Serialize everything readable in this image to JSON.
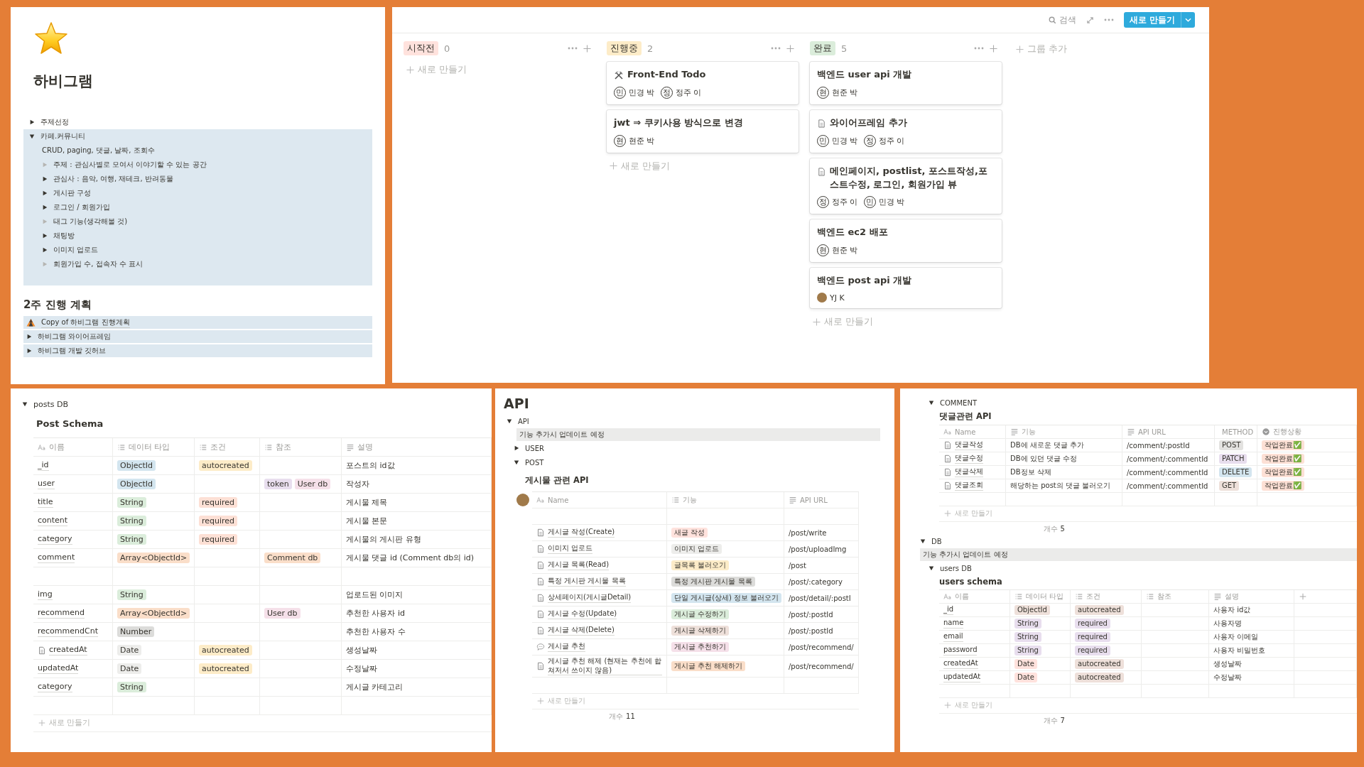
{
  "overview": {
    "title": "하비그램",
    "toggles": [
      {
        "label": "주제선정",
        "expanded": false,
        "empty": false
      },
      {
        "label": "카페.커뮤니티",
        "expanded": true,
        "empty": false,
        "note": "CRUD, paging, 댓글, 날짜, 조회수",
        "children": [
          {
            "label": "주제 : 관심사별로 모여서 이야기할 수 있는 공간",
            "expanded": false,
            "empty": true
          },
          {
            "label": "관심사 : 음악, 여행, 재테크, 반려동물",
            "expanded": false,
            "empty": false
          },
          {
            "label": "게시판 구성",
            "expanded": false,
            "empty": false
          },
          {
            "label": "로그인 / 회원가입",
            "expanded": false,
            "empty": false
          },
          {
            "label": "태그 기능(생각해볼 것)",
            "expanded": false,
            "empty": true
          },
          {
            "label": "채팅방",
            "expanded": false,
            "empty": false
          },
          {
            "label": "이미지 업로드",
            "expanded": false,
            "empty": false
          },
          {
            "label": "회원가입 수, 접속자 수 표시",
            "expanded": false,
            "empty": true
          }
        ]
      }
    ],
    "plan_title": "2주 진행 계획",
    "plan_items": [
      {
        "kind": "link",
        "label": "Copy of 하비그램 진행계획"
      },
      {
        "kind": "toggle",
        "label": "하비그램 와이어프레임",
        "expanded": false
      },
      {
        "kind": "toggle",
        "label": "하비그램 개발 깃허브",
        "expanded": false
      }
    ]
  },
  "board": {
    "search": "검색",
    "new_button": "새로 만들기",
    "add_group": "그룹 추가",
    "columns": [
      {
        "label": "시작전",
        "count": "0",
        "color": "#ffe2dd",
        "new_label": "새로 만들기"
      },
      {
        "label": "진행중",
        "count": "2",
        "color": "#fdecc8",
        "new_label": "새로 만들기",
        "cards": [
          {
            "kind": "tools",
            "title": "Front-End Todo",
            "people": [
              {
                "kind": "initial",
                "initial": "민",
                "name": "민경 박"
              },
              {
                "kind": "initial",
                "initial": "정",
                "name": "정주 이"
              }
            ]
          },
          {
            "kind": "plain",
            "title": "jwt ⇒ 쿠키사용 방식으로 변경",
            "people": [
              {
                "kind": "initial",
                "initial": "현",
                "name": "현준 박"
              }
            ]
          }
        ]
      },
      {
        "label": "완료",
        "count": "5",
        "color": "#dbeddb",
        "new_label": "새로 만들기",
        "cards": [
          {
            "kind": "plain",
            "title": "백엔드 user api 개발",
            "people": [
              {
                "kind": "initial",
                "initial": "현",
                "name": "현준 박"
              }
            ]
          },
          {
            "kind": "page",
            "title": "와이어프레임 추가",
            "people": [
              {
                "kind": "initial",
                "initial": "민",
                "name": "민경 박"
              },
              {
                "kind": "initial",
                "initial": "정",
                "name": "정주 이"
              }
            ]
          },
          {
            "kind": "page",
            "title": "메인페이지, postlist, 포스트작성,포스트수정,  로그인, 회원가입 뷰",
            "people": [
              {
                "kind": "initial",
                "initial": "정",
                "name": "정주 이"
              },
              {
                "kind": "initial",
                "initial": "민",
                "name": "민경 박"
              }
            ]
          },
          {
            "kind": "plain",
            "title": "백엔드 ec2 배포",
            "people": [
              {
                "kind": "initial",
                "initial": "현",
                "name": "현준 박"
              }
            ]
          },
          {
            "kind": "plain",
            "title": "백엔드 post api 개발",
            "people": [
              {
                "kind": "photo",
                "name": "YJ K"
              }
            ]
          }
        ]
      }
    ]
  },
  "posts_db": {
    "label": "posts DB",
    "expanded": true,
    "table_title": "Post Schema",
    "table": {
      "columns": [
        {
          "label": "이름",
          "kind": "title"
        },
        {
          "label": "데이터 타입",
          "kind": "multi"
        },
        {
          "label": "조건",
          "kind": "multi"
        },
        {
          "label": "참조",
          "kind": "multi"
        },
        {
          "label": "설명",
          "kind": "text"
        }
      ],
      "rows": [
        {
          "kind": "entry",
          "cells": [
            {
              "text": "_id"
            },
            {
              "tags": [
                {
                  "text": "ObjectId",
                  "color": "#d3e5ef"
                }
              ]
            },
            {
              "tags": [
                {
                  "text": "autocreated",
                  "color": "#fdecc8"
                }
              ]
            },
            {},
            {
              "text": "포스트의 id값"
            }
          ]
        },
        {
          "kind": "entry",
          "cells": [
            {
              "text": "user"
            },
            {
              "tags": [
                {
                  "text": "ObjectId",
                  "color": "#d3e5ef"
                }
              ]
            },
            {},
            {
              "tags": [
                {
                  "text": "token",
                  "color": "#e8deee"
                },
                {
                  "text": "User db",
                  "color": "#f5e0e9"
                }
              ]
            },
            {
              "text": "작성자"
            }
          ]
        },
        {
          "kind": "entry",
          "cells": [
            {
              "text": "title"
            },
            {
              "tags": [
                {
                  "text": "String",
                  "color": "#dbeddb"
                }
              ]
            },
            {
              "tags": [
                {
                  "text": "required",
                  "color": "#fde0d5"
                }
              ]
            },
            {},
            {
              "text": "게시물 제목"
            }
          ]
        },
        {
          "kind": "entry",
          "cells": [
            {
              "text": "content"
            },
            {
              "tags": [
                {
                  "text": "String",
                  "color": "#dbeddb"
                }
              ]
            },
            {
              "tags": [
                {
                  "text": "required",
                  "color": "#fde0d5"
                }
              ]
            },
            {},
            {
              "text": "게시물 본문"
            }
          ]
        },
        {
          "kind": "entry",
          "cells": [
            {
              "text": "category"
            },
            {
              "tags": [
                {
                  "text": "String",
                  "color": "#dbeddb"
                }
              ]
            },
            {
              "tags": [
                {
                  "text": "required",
                  "color": "#fde0d5"
                }
              ]
            },
            {},
            {
              "text": "게시물의 게시판 유형"
            }
          ]
        },
        {
          "kind": "entry",
          "cells": [
            {
              "text": "comment"
            },
            {
              "tags": [
                {
                  "text": "Array<ObjectId>",
                  "color": "#fadec9"
                }
              ]
            },
            {},
            {
              "tags": [
                {
                  "text": "Comment db",
                  "color": "#fadec9"
                }
              ]
            },
            {
              "text": "게시물 댓글 id (Comment db의 id)"
            }
          ]
        },
        {
          "kind": "blank"
        },
        {
          "kind": "entry",
          "cells": [
            {
              "text": "img"
            },
            {
              "tags": [
                {
                  "text": "String",
                  "color": "#dbeddb"
                }
              ]
            },
            {},
            {},
            {
              "text": "업로드된 이미지"
            }
          ]
        },
        {
          "kind": "entry",
          "cells": [
            {
              "text": "recommend"
            },
            {
              "tags": [
                {
                  "text": "Array<ObjectId>",
                  "color": "#fadec9"
                }
              ]
            },
            {},
            {
              "tags": [
                {
                  "text": "User db",
                  "color": "#f5e0e9"
                }
              ]
            },
            {
              "text": "추천한 사용자 id"
            }
          ]
        },
        {
          "kind": "entry",
          "cells": [
            {
              "text": "recommendCnt"
            },
            {
              "tags": [
                {
                  "text": "Number",
                  "color": "#dcdcda"
                }
              ]
            },
            {},
            {},
            {
              "text": "추천한 사용자 수"
            }
          ]
        },
        {
          "kind": "entry",
          "cells": [
            {
              "text": "createdAt",
              "kind": "page"
            },
            {
              "tags": [
                {
                  "text": "Date",
                  "color": "#ededeb"
                }
              ]
            },
            {
              "tags": [
                {
                  "text": "autocreated",
                  "color": "#fdecc8"
                }
              ]
            },
            {},
            {
              "text": "생성날짜"
            }
          ]
        },
        {
          "kind": "entry",
          "cells": [
            {
              "text": "updatedAt"
            },
            {
              "tags": [
                {
                  "text": "Date",
                  "color": "#ededeb"
                }
              ]
            },
            {
              "tags": [
                {
                  "text": "autocreated",
                  "color": "#fdecc8"
                }
              ]
            },
            {},
            {
              "text": "수정날짜"
            }
          ]
        },
        {
          "kind": "entry",
          "cells": [
            {
              "text": "category"
            },
            {
              "tags": [
                {
                  "text": "String",
                  "color": "#dbeddb"
                }
              ]
            },
            {},
            {},
            {
              "text": "게시글 카테고리"
            }
          ]
        },
        {
          "kind": "blank"
        }
      ],
      "new_label": "새로 만들기"
    }
  },
  "api_page": {
    "title": "API",
    "toggle": {
      "label": "API",
      "expanded": true
    },
    "callout": "기능 추가시 업데이트 예정",
    "sections": [
      {
        "label": "USER",
        "expanded": false
      },
      {
        "label": "POST",
        "expanded": true
      }
    ],
    "table_title": "게시물 관련 API",
    "table": {
      "columns": [
        {
          "label": "Name",
          "kind": "title"
        },
        {
          "label": "기능",
          "kind": "multi"
        },
        {
          "label": "API URL",
          "kind": "text"
        }
      ],
      "rows": [
        {
          "kind": "blank"
        },
        {
          "kind": "entry",
          "cells": [
            {
              "text": "게시글 작성(Create)",
              "kind": "page"
            },
            {
              "tags": [
                {
                  "text": "새글 작성",
                  "color": "#ffe2dd"
                }
              ]
            },
            {
              "text": "/post/write"
            }
          ]
        },
        {
          "kind": "entry",
          "cells": [
            {
              "text": "이미지 업로드",
              "kind": "page"
            },
            {
              "tags": [
                {
                  "text": "이미지 업로드",
                  "color": "#ededeb"
                }
              ]
            },
            {
              "text": "/post/uploadImg"
            }
          ]
        },
        {
          "kind": "entry",
          "cells": [
            {
              "text": "게시글 목록(Read)",
              "kind": "page"
            },
            {
              "tags": [
                {
                  "text": "글목록 불러오기",
                  "color": "#fdecc8"
                }
              ]
            },
            {
              "text": "/post"
            }
          ]
        },
        {
          "kind": "entry",
          "cells": [
            {
              "text": "특정 게시판 게시물 목록",
              "kind": "page"
            },
            {
              "tags": [
                {
                  "text": "특정 게시판 게시물 목록",
                  "color": "#dcdcda"
                }
              ]
            },
            {
              "text": "/post/:category"
            }
          ]
        },
        {
          "kind": "entry",
          "cells": [
            {
              "text": "상세페이지(게시글Detail)",
              "kind": "page"
            },
            {
              "tags": [
                {
                  "text": "단일 게시글(상세) 정보 불러오기",
                  "color": "#d3e5ef"
                }
              ]
            },
            {
              "text": "/post/detail/:postI"
            }
          ]
        },
        {
          "kind": "entry",
          "cells": [
            {
              "text": "게시글 수정(Update)",
              "kind": "page"
            },
            {
              "tags": [
                {
                  "text": "게시글 수정하기",
                  "color": "#dbeddb"
                }
              ]
            },
            {
              "text": "/post/:postId"
            }
          ]
        },
        {
          "kind": "entry",
          "cells": [
            {
              "text": "게시글 삭제(Delete)",
              "kind": "page"
            },
            {
              "tags": [
                {
                  "text": "게시글 삭제하기",
                  "color": "#eee0da"
                }
              ]
            },
            {
              "text": "/post/:postId"
            }
          ]
        },
        {
          "kind": "entry",
          "cells": [
            {
              "text": "게시글 추천",
              "kind": "bubble"
            },
            {
              "tags": [
                {
                  "text": "게시글 추천하기",
                  "color": "#f5e0e9"
                }
              ]
            },
            {
              "text": "/post/recommend/"
            }
          ]
        },
        {
          "kind": "entry",
          "cells": [
            {
              "text": "게시글 추천 해제 (현재는 추천에 합쳐저서 쓰이지 않음)",
              "kind": "page"
            },
            {
              "tags": [
                {
                  "text": "게시글 추천 해제하기",
                  "color": "#fadec9"
                }
              ]
            },
            {
              "text": "/post/recommend/"
            }
          ]
        },
        {
          "kind": "blank"
        }
      ],
      "new_label": "새로 만들기",
      "count_label": "개수",
      "count": "11"
    }
  },
  "comment_section": {
    "label": "COMMENT",
    "expanded": true,
    "table_title": "댓글관련 API",
    "table": {
      "columns": [
        {
          "label": "Name",
          "kind": "title"
        },
        {
          "label": "기능",
          "kind": "text"
        },
        {
          "label": "API URL",
          "kind": "text"
        },
        {
          "label": "METHOD",
          "kind": "select"
        },
        {
          "label": "진행상황",
          "kind": "select"
        }
      ],
      "rows": [
        {
          "kind": "entry",
          "cells": [
            {
              "text": "댓글작성",
              "kind": "page"
            },
            {
              "text": "DB에 새로운 댓글 추가"
            },
            {
              "text": "/comment/:postId"
            },
            {
              "tags": [
                {
                  "text": "POST",
                  "color": "#e3e2e0"
                }
              ]
            },
            {
              "tags": [
                {
                  "text": "작업완료✅",
                  "color": "#fde0d5"
                }
              ]
            }
          ]
        },
        {
          "kind": "entry",
          "cells": [
            {
              "text": "댓글수정",
              "kind": "page"
            },
            {
              "text": "DB에 있던 댓글 수정"
            },
            {
              "text": "/comment/:commentId"
            },
            {
              "tags": [
                {
                  "text": "PATCH",
                  "color": "#e8deee"
                }
              ]
            },
            {
              "tags": [
                {
                  "text": "작업완료✅",
                  "color": "#fde0d5"
                }
              ]
            }
          ]
        },
        {
          "kind": "entry",
          "cells": [
            {
              "text": "댓글삭제",
              "kind": "page"
            },
            {
              "text": "DB정보 삭제"
            },
            {
              "text": "/comment/:commentId"
            },
            {
              "tags": [
                {
                  "text": "DELETE",
                  "color": "#d3e5ef"
                }
              ]
            },
            {
              "tags": [
                {
                  "text": "작업완료✅",
                  "color": "#fde0d5"
                }
              ]
            }
          ]
        },
        {
          "kind": "entry",
          "cells": [
            {
              "text": "댓글조회",
              "kind": "page"
            },
            {
              "text": "해당하는 post의 댓글 불러오기"
            },
            {
              "text": "/comment/:commentId"
            },
            {
              "tags": [
                {
                  "text": "GET",
                  "color": "#eee0da"
                }
              ]
            },
            {
              "tags": [
                {
                  "text": "작업완료✅",
                  "color": "#fde0d5"
                }
              ]
            }
          ]
        },
        {
          "kind": "blank"
        }
      ],
      "new_label": "새로 만들기",
      "count_label": "개수",
      "count": "5"
    }
  },
  "db_section": {
    "label": "DB",
    "expanded": true,
    "callout": "기능 추가시 업데이트 예정",
    "sub": {
      "label": "users DB",
      "expanded": true,
      "table_title": "users schema",
      "table": {
        "columns": [
          {
            "label": "이름",
            "kind": "title"
          },
          {
            "label": "데이터 타입",
            "kind": "multi"
          },
          {
            "label": "조건",
            "kind": "multi"
          },
          {
            "label": "참조",
            "kind": "multi"
          },
          {
            "label": "설명",
            "kind": "text"
          }
        ],
        "rows": [
          {
            "kind": "entry",
            "cells": [
              {
                "text": "_id"
              },
              {
                "tags": [
                  {
                    "text": "ObjectId",
                    "color": "#eee0da"
                  }
                ]
              },
              {
                "tags": [
                  {
                    "text": "autocreated",
                    "color": "#eee0da"
                  }
                ]
              },
              {},
              {
                "text": "사용자 id값"
              }
            ]
          },
          {
            "kind": "entry",
            "cells": [
              {
                "text": "name"
              },
              {
                "tags": [
                  {
                    "text": "String",
                    "color": "#e8deee"
                  }
                ]
              },
              {
                "tags": [
                  {
                    "text": "required",
                    "color": "#e8deee"
                  }
                ]
              },
              {},
              {
                "text": "사용자명"
              }
            ]
          },
          {
            "kind": "entry",
            "cells": [
              {
                "text": "email"
              },
              {
                "tags": [
                  {
                    "text": "String",
                    "color": "#e8deee"
                  }
                ]
              },
              {
                "tags": [
                  {
                    "text": "required",
                    "color": "#e8deee"
                  }
                ]
              },
              {},
              {
                "text": "사용자 이메일"
              }
            ]
          },
          {
            "kind": "entry",
            "cells": [
              {
                "text": "password"
              },
              {
                "tags": [
                  {
                    "text": "String",
                    "color": "#e8deee"
                  }
                ]
              },
              {
                "tags": [
                  {
                    "text": "required",
                    "color": "#e8deee"
                  }
                ]
              },
              {},
              {
                "text": "사용자 비밀번호"
              }
            ]
          },
          {
            "kind": "entry",
            "cells": [
              {
                "text": "createdAt"
              },
              {
                "tags": [
                  {
                    "text": "Date",
                    "color": "#ffe2dd"
                  }
                ]
              },
              {
                "tags": [
                  {
                    "text": "autocreated",
                    "color": "#eee0da"
                  }
                ]
              },
              {},
              {
                "text": "생성날짜"
              }
            ]
          },
          {
            "kind": "entry",
            "cells": [
              {
                "text": "updatedAt"
              },
              {
                "tags": [
                  {
                    "text": "Date",
                    "color": "#ffe2dd"
                  }
                ]
              },
              {
                "tags": [
                  {
                    "text": "autocreated",
                    "color": "#eee0da"
                  }
                ]
              },
              {},
              {
                "text": "수정날짜"
              }
            ]
          },
          {
            "kind": "blank"
          }
        ],
        "new_label": "새로 만들기",
        "count_label": "개수",
        "count": "7"
      }
    }
  }
}
